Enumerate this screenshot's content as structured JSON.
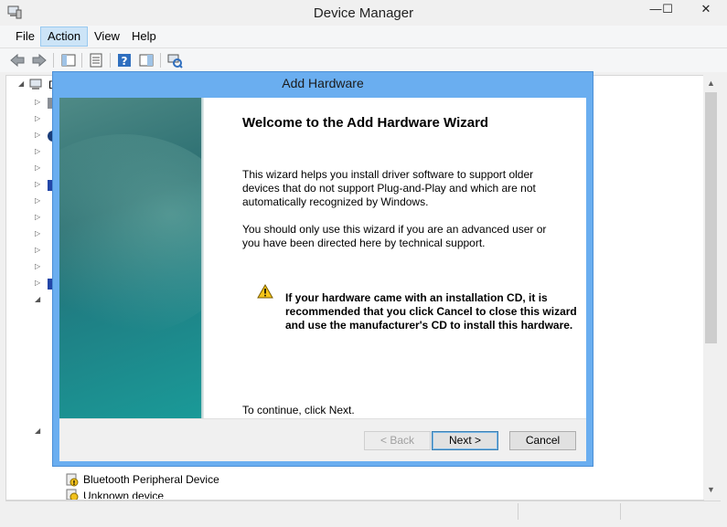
{
  "window": {
    "title": "Device Manager",
    "controls": {
      "minimize": "—",
      "maximize": "☐",
      "close": "✕"
    }
  },
  "menubar": {
    "items": [
      {
        "label": "File",
        "active": false
      },
      {
        "label": "Action",
        "active": true
      },
      {
        "label": "View",
        "active": false
      },
      {
        "label": "Help",
        "active": false
      }
    ]
  },
  "toolbar": {
    "icons": [
      "back-arrow-icon",
      "forward-arrow-icon",
      "console-tree-icon",
      "properties-icon",
      "help-icon",
      "action-pane-icon",
      "scan-hardware-icon"
    ]
  },
  "tree": {
    "root_label_fragment": "D",
    "visible_items": [
      {
        "label": "Bluetooth Peripheral Device"
      },
      {
        "label": "Unknown device"
      }
    ]
  },
  "dialog": {
    "title": "Add Hardware",
    "heading": "Welcome to the Add Hardware Wizard",
    "paragraph1": "This wizard helps you install driver software to support older devices that do not support Plug-and-Play and which are not automatically recognized by Windows.",
    "paragraph2": "You should only use this wizard if you are an advanced user or you have been directed here by technical support.",
    "warning": "If your hardware came with an installation CD, it is recommended that you click Cancel to close this wizard and use the manufacturer's CD to install this hardware.",
    "continue_text": "To continue, click Next.",
    "buttons": {
      "back": "< Back",
      "next": "Next >",
      "cancel": "Cancel"
    }
  },
  "colors": {
    "dialog_frame": "#6aaef0",
    "menu_active": "#cce4f7",
    "wizard_side": "#1f7f84"
  }
}
